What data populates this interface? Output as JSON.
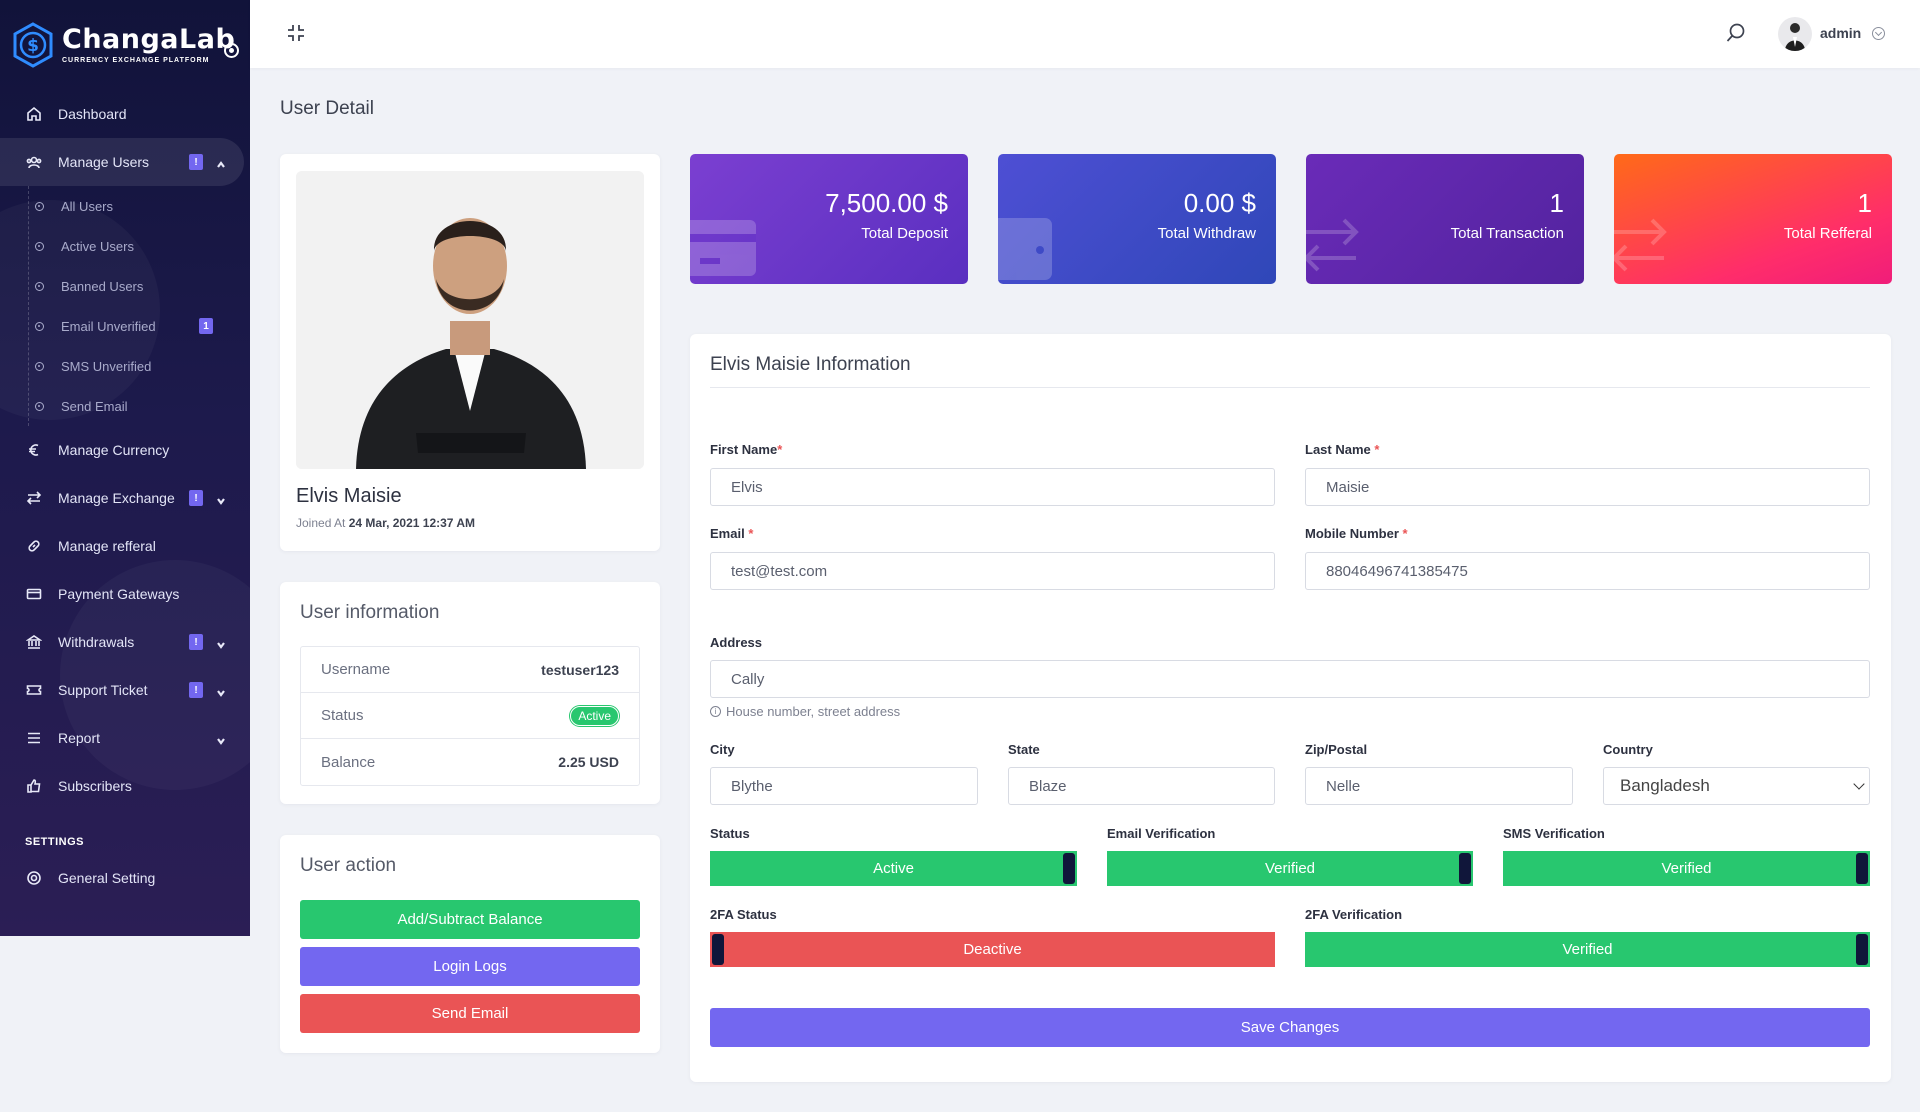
{
  "brand": {
    "name": "ChangaLab",
    "tagline": "CURRENCY EXCHANGE PLATFORM"
  },
  "sidebar": {
    "items": [
      {
        "label": "Dashboard",
        "icon": "home-icon"
      },
      {
        "label": "Manage Users",
        "icon": "users-icon",
        "badge": "!"
      },
      {
        "label": "Manage Currency",
        "icon": "euro-icon"
      },
      {
        "label": "Manage Exchange",
        "icon": "exchange-icon",
        "badge": "!"
      },
      {
        "label": "Manage refferal",
        "icon": "link-icon"
      },
      {
        "label": "Payment Gateways",
        "icon": "credit-card-icon"
      },
      {
        "label": "Withdrawals",
        "icon": "bank-icon",
        "badge": "!"
      },
      {
        "label": "Support Ticket",
        "icon": "ticket-icon",
        "badge": "!"
      },
      {
        "label": "Report",
        "icon": "list-icon"
      },
      {
        "label": "Subscribers",
        "icon": "thumbs-up-icon"
      },
      {
        "label": "General Setting",
        "icon": "settings-icon"
      }
    ],
    "sub_items": [
      {
        "label": "All Users"
      },
      {
        "label": "Active Users"
      },
      {
        "label": "Banned Users"
      },
      {
        "label": "Email Unverified",
        "badge": "1"
      },
      {
        "label": "SMS Unverified"
      },
      {
        "label": "Send Email"
      }
    ],
    "settings_label": "SETTINGS"
  },
  "header": {
    "username": "admin"
  },
  "page": {
    "title": "User Detail"
  },
  "profile": {
    "name": "Elvis Maisie",
    "joined_prefix": "Joined At",
    "joined_date": "24 Mar, 2021 12:37 AM"
  },
  "user_info": {
    "title": "User information",
    "rows": [
      {
        "key": "Username",
        "value": "testuser123"
      },
      {
        "key": "Status",
        "value": "Active"
      },
      {
        "key": "Balance",
        "value": "2.25 USD"
      }
    ]
  },
  "user_action": {
    "title": "User action",
    "buttons": [
      {
        "label": "Add/Subtract Balance",
        "color": "#28c76f"
      },
      {
        "label": "Login Logs",
        "color": "#7367f0"
      },
      {
        "label": "Send Email",
        "color": "#ea5455"
      }
    ]
  },
  "stats": [
    {
      "value": "7,500.00 $",
      "label": "Total Deposit",
      "icon": "credit-card-icon"
    },
    {
      "value": "0.00 $",
      "label": "Total Withdraw",
      "icon": "wallet-icon"
    },
    {
      "value": "1",
      "label": "Total Transaction",
      "icon": "exchange-icon"
    },
    {
      "value": "1",
      "label": "Total Refferal",
      "icon": "exchange-icon"
    }
  ],
  "form": {
    "title": "Elvis Maisie Information",
    "first_name": {
      "label": "First Name",
      "value": "Elvis"
    },
    "last_name": {
      "label": "Last Name",
      "value": "Maisie"
    },
    "email": {
      "label": "Email",
      "value": "test@test.com"
    },
    "mobile": {
      "label": "Mobile Number",
      "value": "88046496741385475"
    },
    "address": {
      "label": "Address",
      "value": "Cally",
      "hint": "House number, street address"
    },
    "city": {
      "label": "City",
      "value": "Blythe"
    },
    "state": {
      "label": "State",
      "value": "Blaze"
    },
    "zip": {
      "label": "Zip/Postal",
      "value": "Nelle"
    },
    "country": {
      "label": "Country",
      "value": "Bangladesh"
    },
    "status": {
      "label": "Status",
      "value": "Active",
      "on": true
    },
    "email_verification": {
      "label": "Email Verification",
      "value": "Verified",
      "on": true
    },
    "sms_verification": {
      "label": "SMS Verification",
      "value": "Verified",
      "on": true
    },
    "twofa_status": {
      "label": "2FA Status",
      "value": "Deactive",
      "on": false
    },
    "twofa_verification": {
      "label": "2FA Verification",
      "value": "Verified",
      "on": true
    },
    "save_label": "Save Changes"
  },
  "colors": {
    "primary": "#7367f0",
    "success": "#28c76f",
    "danger": "#ea5455",
    "sidebar": "#1b1a4a"
  }
}
